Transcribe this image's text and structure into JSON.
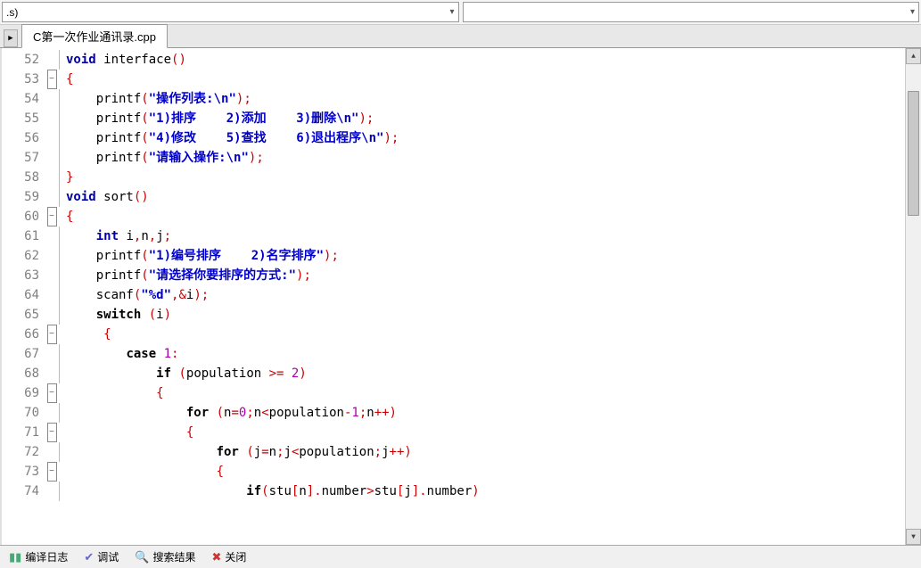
{
  "top": {
    "left_dropdown": ".s)",
    "right_dropdown": ""
  },
  "tab": {
    "filename": "C第一次作业通讯录.cpp"
  },
  "gutter_start": 52,
  "gutter_end": 74,
  "fold_rows": {
    "53": "minus",
    "60": "minus",
    "66": "minus",
    "69": "minus",
    "71": "minus",
    "73": "minus"
  },
  "code_lines": [
    [
      {
        "t": "ty",
        "v": "void"
      },
      {
        "t": "pn",
        "v": " interface"
      },
      {
        "t": "op",
        "v": "()"
      }
    ],
    [
      {
        "t": "op",
        "v": "{"
      }
    ],
    [
      {
        "t": "pn",
        "v": "    printf"
      },
      {
        "t": "op",
        "v": "("
      },
      {
        "t": "str",
        "v": "\"操作列表:\\n\""
      },
      {
        "t": "op",
        "v": ");"
      }
    ],
    [
      {
        "t": "pn",
        "v": "    printf"
      },
      {
        "t": "op",
        "v": "("
      },
      {
        "t": "str",
        "v": "\"1)排序    2)添加    3)删除\\n\""
      },
      {
        "t": "op",
        "v": ");"
      }
    ],
    [
      {
        "t": "pn",
        "v": "    printf"
      },
      {
        "t": "op",
        "v": "("
      },
      {
        "t": "str",
        "v": "\"4)修改    5)查找    6)退出程序\\n\""
      },
      {
        "t": "op",
        "v": ");"
      }
    ],
    [
      {
        "t": "pn",
        "v": "    printf"
      },
      {
        "t": "op",
        "v": "("
      },
      {
        "t": "str",
        "v": "\"请输入操作:\\n\""
      },
      {
        "t": "op",
        "v": ");"
      }
    ],
    [
      {
        "t": "op",
        "v": "}"
      }
    ],
    [
      {
        "t": "ty",
        "v": "void"
      },
      {
        "t": "pn",
        "v": " sort"
      },
      {
        "t": "op",
        "v": "()"
      }
    ],
    [
      {
        "t": "op",
        "v": "{"
      }
    ],
    [
      {
        "t": "pn",
        "v": "    "
      },
      {
        "t": "ty",
        "v": "int"
      },
      {
        "t": "pn",
        "v": " i"
      },
      {
        "t": "op",
        "v": ","
      },
      {
        "t": "pn",
        "v": "n"
      },
      {
        "t": "op",
        "v": ","
      },
      {
        "t": "pn",
        "v": "j"
      },
      {
        "t": "op",
        "v": ";"
      }
    ],
    [
      {
        "t": "pn",
        "v": "    printf"
      },
      {
        "t": "op",
        "v": "("
      },
      {
        "t": "str",
        "v": "\"1)编号排序    2)名字排序\""
      },
      {
        "t": "op",
        "v": ");"
      }
    ],
    [
      {
        "t": "pn",
        "v": "    printf"
      },
      {
        "t": "op",
        "v": "("
      },
      {
        "t": "str",
        "v": "\"请选择你要排序的方式:\""
      },
      {
        "t": "op",
        "v": ");"
      }
    ],
    [
      {
        "t": "pn",
        "v": "    scanf"
      },
      {
        "t": "op",
        "v": "("
      },
      {
        "t": "str",
        "v": "\"%d\""
      },
      {
        "t": "op",
        "v": ",&"
      },
      {
        "t": "pn",
        "v": "i"
      },
      {
        "t": "op",
        "v": ");"
      }
    ],
    [
      {
        "t": "pn",
        "v": "    "
      },
      {
        "t": "kw",
        "v": "switch"
      },
      {
        "t": "pn",
        "v": " "
      },
      {
        "t": "op",
        "v": "("
      },
      {
        "t": "pn",
        "v": "i"
      },
      {
        "t": "op",
        "v": ")"
      }
    ],
    [
      {
        "t": "pn",
        "v": "     "
      },
      {
        "t": "op",
        "v": "{"
      }
    ],
    [
      {
        "t": "pn",
        "v": "        "
      },
      {
        "t": "kw",
        "v": "case"
      },
      {
        "t": "pn",
        "v": " "
      },
      {
        "t": "num",
        "v": "1"
      },
      {
        "t": "op",
        "v": ":"
      }
    ],
    [
      {
        "t": "pn",
        "v": "            "
      },
      {
        "t": "kw",
        "v": "if"
      },
      {
        "t": "pn",
        "v": " "
      },
      {
        "t": "op",
        "v": "("
      },
      {
        "t": "pn",
        "v": "population "
      },
      {
        "t": "op",
        "v": ">="
      },
      {
        "t": "pn",
        "v": " "
      },
      {
        "t": "num",
        "v": "2"
      },
      {
        "t": "op",
        "v": ")"
      }
    ],
    [
      {
        "t": "pn",
        "v": "            "
      },
      {
        "t": "op",
        "v": "{"
      }
    ],
    [
      {
        "t": "pn",
        "v": "                "
      },
      {
        "t": "kw",
        "v": "for"
      },
      {
        "t": "pn",
        "v": " "
      },
      {
        "t": "op",
        "v": "("
      },
      {
        "t": "pn",
        "v": "n"
      },
      {
        "t": "op",
        "v": "="
      },
      {
        "t": "num",
        "v": "0"
      },
      {
        "t": "op",
        "v": ";"
      },
      {
        "t": "pn",
        "v": "n"
      },
      {
        "t": "op",
        "v": "<"
      },
      {
        "t": "pn",
        "v": "population"
      },
      {
        "t": "op",
        "v": "-"
      },
      {
        "t": "num",
        "v": "1"
      },
      {
        "t": "op",
        "v": ";"
      },
      {
        "t": "pn",
        "v": "n"
      },
      {
        "t": "op",
        "v": "++)"
      }
    ],
    [
      {
        "t": "pn",
        "v": "                "
      },
      {
        "t": "op",
        "v": "{"
      }
    ],
    [
      {
        "t": "pn",
        "v": "                    "
      },
      {
        "t": "kw",
        "v": "for"
      },
      {
        "t": "pn",
        "v": " "
      },
      {
        "t": "op",
        "v": "("
      },
      {
        "t": "pn",
        "v": "j"
      },
      {
        "t": "op",
        "v": "="
      },
      {
        "t": "pn",
        "v": "n"
      },
      {
        "t": "op",
        "v": ";"
      },
      {
        "t": "pn",
        "v": "j"
      },
      {
        "t": "op",
        "v": "<"
      },
      {
        "t": "pn",
        "v": "population"
      },
      {
        "t": "op",
        "v": ";"
      },
      {
        "t": "pn",
        "v": "j"
      },
      {
        "t": "op",
        "v": "++)"
      }
    ],
    [
      {
        "t": "pn",
        "v": "                    "
      },
      {
        "t": "op",
        "v": "{"
      }
    ],
    [
      {
        "t": "pn",
        "v": "                        "
      },
      {
        "t": "kw",
        "v": "if"
      },
      {
        "t": "op",
        "v": "("
      },
      {
        "t": "pn",
        "v": "stu"
      },
      {
        "t": "op",
        "v": "["
      },
      {
        "t": "pn",
        "v": "n"
      },
      {
        "t": "op",
        "v": "]."
      },
      {
        "t": "pn",
        "v": "number"
      },
      {
        "t": "op",
        "v": ">"
      },
      {
        "t": "pn",
        "v": "stu"
      },
      {
        "t": "op",
        "v": "["
      },
      {
        "t": "pn",
        "v": "j"
      },
      {
        "t": "op",
        "v": "]."
      },
      {
        "t": "pn",
        "v": "number"
      },
      {
        "t": "op",
        "v": ")"
      }
    ]
  ],
  "status": {
    "compile_log": "编译日志",
    "debug": "调试",
    "search_results": "搜索结果",
    "close": "关闭"
  }
}
